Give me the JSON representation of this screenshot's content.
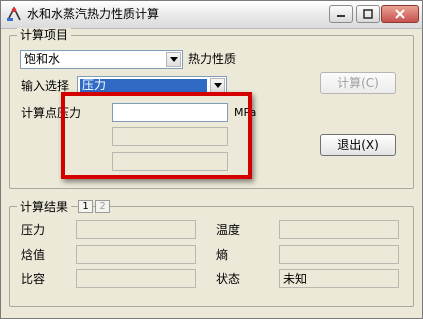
{
  "window": {
    "title": "水和水蒸汽热力性质计算",
    "icon": "app-icon",
    "controls": [
      "minimize-icon",
      "maximize-icon",
      "close-icon"
    ]
  },
  "calc_item_group": {
    "label": "计算项目",
    "substance_select": {
      "value": "饱和水"
    },
    "property_label": "热力性质",
    "input_select_label": "输入选择",
    "input_select": {
      "value": "压力"
    },
    "calc_point_label": "计算点压力",
    "pressure_input": {
      "value": ""
    },
    "unit": "MPa",
    "buttons": {
      "calculate": "计算(C)",
      "exit": "退出(X)"
    }
  },
  "results_group": {
    "label": "计算结果",
    "tabs": [
      "1",
      "2"
    ],
    "active_tab": "1",
    "fields": {
      "pressure": {
        "label": "压力",
        "value": ""
      },
      "temperature": {
        "label": "温度",
        "value": ""
      },
      "enthalpy": {
        "label": "焓值",
        "value": ""
      },
      "entropy": {
        "label": "熵",
        "value": ""
      },
      "specific_volume": {
        "label": "比容",
        "value": ""
      },
      "state": {
        "label": "状态",
        "value": "未知"
      }
    }
  },
  "annotation": {
    "type": "highlight-rectangle",
    "color": "#d40000"
  }
}
